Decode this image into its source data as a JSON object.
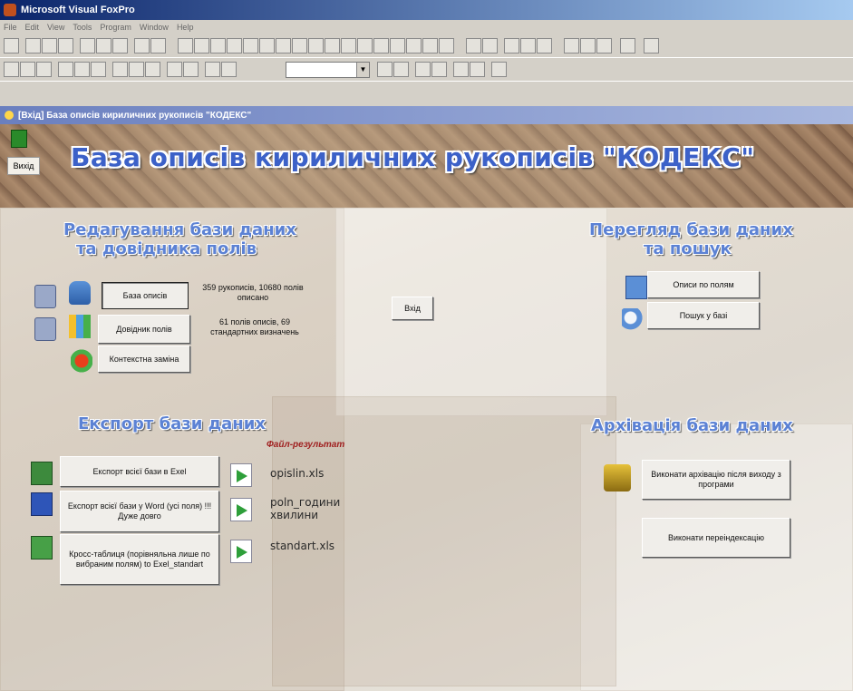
{
  "app": {
    "title": "Microsoft Visual FoxPro",
    "menu": [
      "File",
      "Edit",
      "View",
      "Tools",
      "Program",
      "Window",
      "Help"
    ]
  },
  "window": {
    "title": "[Вхід] База описів кириличних рукописів \"КОДЕКС\""
  },
  "header": {
    "banner": "База описів кириличних рукописів \"КОДЕКС\"",
    "exit_label": "Вихід"
  },
  "edit": {
    "title_line1": "Редагування бази даних",
    "title_line2": "та довідника полів",
    "btn_opysy": "База описів",
    "btn_dovidnyk": "Довідник полів",
    "btn_zamina": "Контекстна заміна",
    "stats1": "359 рукописів, 10680 полів описано",
    "stats2": "61 полів описів, 69 стандартних визначень"
  },
  "center": {
    "exit_btn": "Вхід"
  },
  "view": {
    "title_line1": "Перегляд бази даних",
    "title_line2": "та пошук",
    "btn_fields": "Описи по полям",
    "btn_search": "Пошук у базі"
  },
  "export": {
    "title": "Експорт бази даних",
    "result_label": "Файл-результат",
    "btn_excel": "Експорт всієї бази в Exel",
    "btn_word": "Експорт всієї бази у Word (усі поля) !!! Дуже довго",
    "btn_cross": "Кросс-таблиця (порівняльна лише по вибраним полям) to Exel_standart",
    "file1": "opislin.xls",
    "file2": "poln_години хвилини",
    "file3": "standart.xls"
  },
  "archive": {
    "title": "Архівація бази даних",
    "btn_archive": "Виконати архівацію після виходу з програми",
    "btn_reindex": "Виконати переіндексацію"
  }
}
